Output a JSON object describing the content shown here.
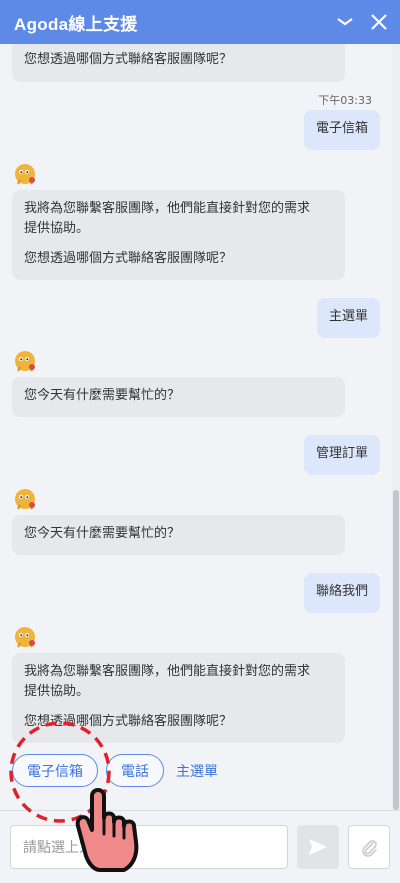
{
  "header": {
    "title": "Agoda線上支援"
  },
  "messages": {
    "m0": "您想透過哪個方式聯絡客服團隊呢？",
    "ts": "下午03:33",
    "u1": "電子信箱",
    "b1_line1": "我將為您聯繫客服團隊，他們能直接針對您的需求",
    "b1_line2": "提供協助。",
    "b1_q": "您想透過哪個方式聯絡客服團隊呢？",
    "u2": "主選單",
    "b2": "您今天有什麼需要幫忙的？",
    "u3": "管理訂單",
    "b3": "您今天有什麼需要幫忙的？",
    "u4": "聯絡我們",
    "b4_line1": "我將為您聯繫客服團隊，他們能直接針對您的需求",
    "b4_line2": "提供協助。",
    "b4_q": "您想透過哪個方式聯絡客服團隊呢？"
  },
  "options": {
    "email": "電子信箱",
    "phone": "電話",
    "main_menu": "主選單"
  },
  "input": {
    "placeholder": "請點選上方"
  },
  "colors": {
    "header": "#5c8ae6",
    "accent": "#3b73d9",
    "bot_bubble": "#e7e8ec",
    "user_bubble": "#dde7fb",
    "highlight": "#e0202a"
  },
  "icons": {
    "minimize": "minimize-icon",
    "close": "close-icon",
    "avatar": "agoda-mascot-icon",
    "send": "send-icon",
    "attach": "paperclip-icon",
    "hand": "pointing-hand-icon"
  }
}
